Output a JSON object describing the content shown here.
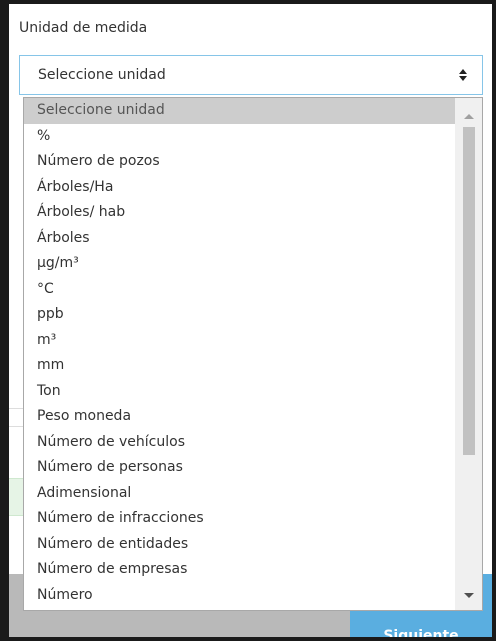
{
  "field": {
    "label": "Unidad de medida",
    "selected_value": "Seleccione unidad"
  },
  "dropdown": {
    "options": [
      {
        "label": "Seleccione unidad",
        "selected": true
      },
      {
        "label": "%"
      },
      {
        "label": "Número de pozos"
      },
      {
        "label": "Árboles/Ha"
      },
      {
        "label": "Árboles/ hab"
      },
      {
        "label": "Árboles"
      },
      {
        "label": "µg/m³"
      },
      {
        "label": "°C"
      },
      {
        "label": "ppb"
      },
      {
        "label": "m³"
      },
      {
        "label": "mm"
      },
      {
        "label": "Ton"
      },
      {
        "label": "Peso moneda"
      },
      {
        "label": "Número de vehículos"
      },
      {
        "label": "Número de personas"
      },
      {
        "label": "Adimensional"
      },
      {
        "label": "Número de infracciones"
      },
      {
        "label": "Número de entidades"
      },
      {
        "label": "Número de empresas"
      },
      {
        "label": "Número"
      }
    ]
  },
  "footer": {
    "next_label": "Siguiente"
  },
  "colors": {
    "select_border": "#86c5e8",
    "selected_option_bg": "#cdcdcd",
    "primary_button": "#5aaee0"
  }
}
